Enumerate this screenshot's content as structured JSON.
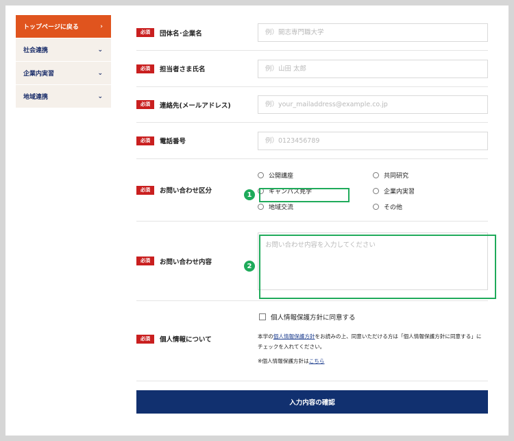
{
  "sidebar": {
    "items": [
      {
        "label": "トップページに戻る",
        "chevron": "›"
      },
      {
        "label": "社会連携",
        "chevron": "⌄"
      },
      {
        "label": "企業内実習",
        "chevron": "⌄"
      },
      {
        "label": "地域連携",
        "chevron": "⌄"
      }
    ]
  },
  "form": {
    "required_badge": "必須",
    "org_name": {
      "label": "団体名･企業名",
      "placeholder": "例）開志専門職大学"
    },
    "contact_name": {
      "label": "担当者さま氏名",
      "placeholder": "例）山田 太郎"
    },
    "email": {
      "label": "連絡先(メールアドレス)",
      "placeholder": "例）your_mailaddress@example.co.jp"
    },
    "phone": {
      "label": "電話番号",
      "placeholder": "例）0123456789"
    },
    "category": {
      "label": "お問い合わせ区分",
      "options": [
        "公開講座",
        "共同研究",
        "キャンパス見学",
        "企業内実習",
        "地域交流",
        "その他"
      ]
    },
    "content": {
      "label": "お問い合わせ内容",
      "placeholder": "お問い合わせ内容を入力してください"
    },
    "privacy": {
      "label": "個人情報について",
      "agree": "個人情報保護方針に同意する",
      "text_before": "本学の",
      "link1": "個人情報保護方針",
      "text_after": "をお読みの上、同意いただける方は「個人情報保護方針に同意する」に",
      "text_line2": "チェックを入れてください。",
      "note_before": "※個人情報保護方針は",
      "link2": "こちら"
    },
    "submit": "入力内容の確認"
  },
  "annotations": {
    "badge1": "1",
    "badge2": "2",
    "color": "#1eaa5a"
  }
}
